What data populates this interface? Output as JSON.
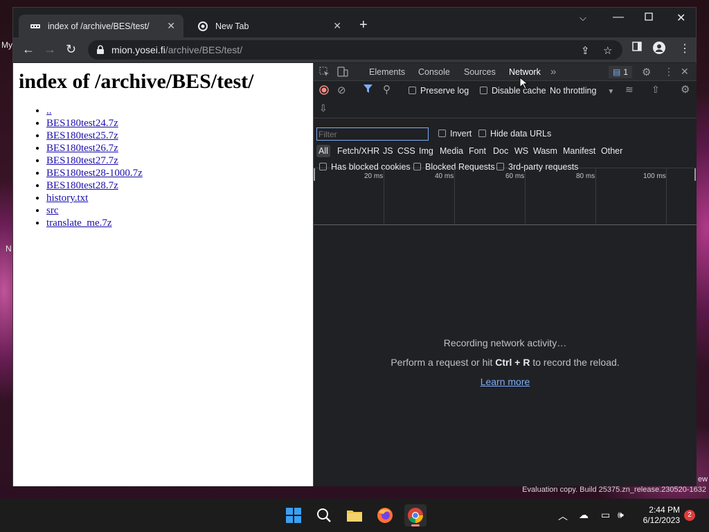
{
  "desktop": {
    "label_top": "My",
    "label_mid": "N",
    "label_ew": "ew",
    "eval_text": "Evaluation copy. Build 25375.zn_release.230520-1632"
  },
  "browser": {
    "tabs": [
      {
        "title": "index of /archive/BES/test/",
        "active": true
      },
      {
        "title": "New Tab",
        "active": false
      }
    ],
    "url_host": "mion.yosei.fi",
    "url_path": "/archive/BES/test/"
  },
  "page": {
    "heading": "index of /archive/BES/test/",
    "links": [
      "..",
      "BES180test24.7z",
      "BES180test25.7z",
      "BES180test26.7z",
      "BES180test27.7z",
      "BES180test28-1000.7z",
      "BES180test28.7z",
      "history.txt",
      "src",
      "translate_me.7z"
    ]
  },
  "devtools": {
    "tabs": [
      "Elements",
      "Console",
      "Sources",
      "Network"
    ],
    "active_tab": "Network",
    "issues_count": "1",
    "preserve_log": "Preserve log",
    "disable_cache": "Disable cache",
    "throttling": "No throttling",
    "filter_placeholder": "Filter",
    "invert": "Invert",
    "hide_data_urls": "Hide data URLs",
    "types": [
      "All",
      "Fetch/XHR",
      "JS",
      "CSS",
      "Img",
      "Media",
      "Font",
      "Doc",
      "WS",
      "Wasm",
      "Manifest",
      "Other"
    ],
    "has_blocked_cookies": "Has blocked cookies",
    "blocked_requests": "Blocked Requests",
    "third_party": "3rd-party requests",
    "timeline_ticks": [
      "20 ms",
      "40 ms",
      "60 ms",
      "80 ms",
      "100 ms"
    ],
    "recording": "Recording network activity…",
    "perform_pre": "Perform a request or hit ",
    "perform_key": "Ctrl + R",
    "perform_post": " to record the reload.",
    "learn_more": "Learn more"
  },
  "taskbar": {
    "time": "2:44 PM",
    "date": "6/12/2023",
    "notifications": "2"
  }
}
